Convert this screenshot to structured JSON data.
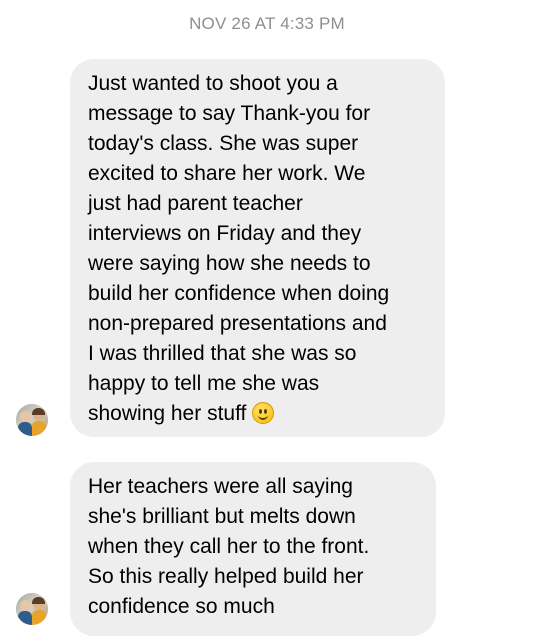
{
  "conversation": {
    "timestamp": "NOV 26 AT 4:33 PM",
    "messages": [
      {
        "lines": [
          "Just wanted to shoot you a",
          "message to say Thank-you for",
          "today's class.  She was super",
          "excited to share her work.  We",
          "just had parent teacher",
          "interviews on Friday and they",
          "were saying how she needs to",
          "build her confidence when doing",
          "non-prepared presentations and",
          "I was thrilled that she was so",
          "happy to tell me she was",
          "showing her stuff"
        ],
        "emoji": "slightly-smiling-face-icon"
      },
      {
        "lines": [
          "Her teachers were all saying",
          "she's brilliant but melts down",
          "when they call her to the front.",
          "So this really helped build her",
          "confidence so much"
        ]
      }
    ]
  },
  "colors": {
    "bubble_background": "#eeeeef",
    "timestamp_text": "#8e8e93",
    "message_text": "#000000"
  }
}
